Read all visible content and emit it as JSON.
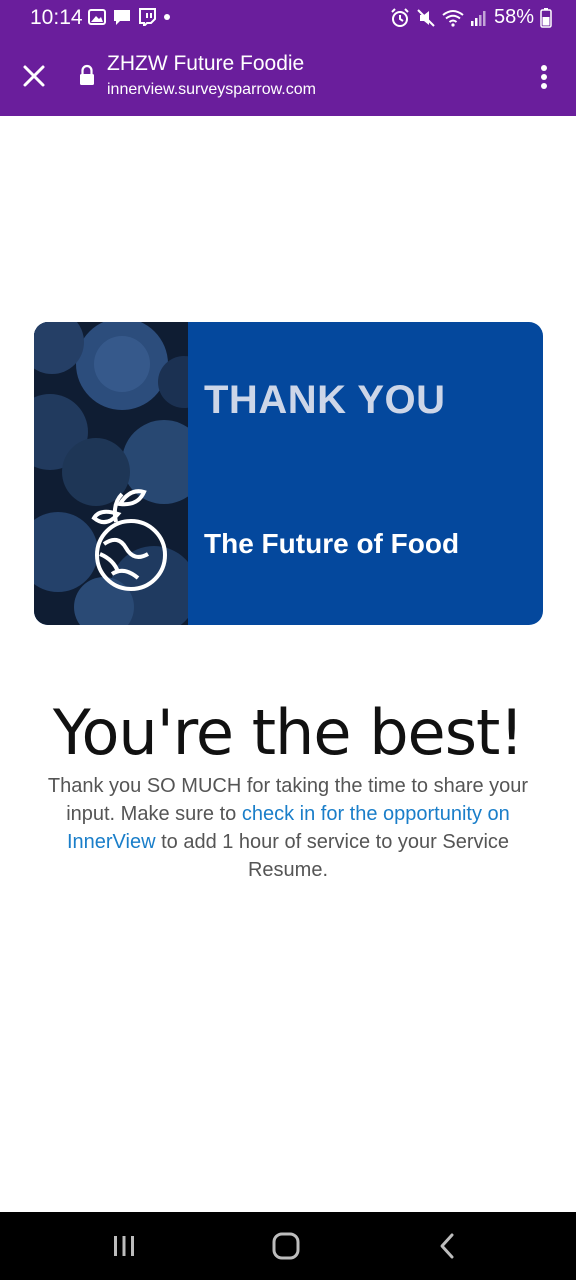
{
  "status_bar": {
    "time": "10:14",
    "battery": "58%",
    "icons": [
      "gallery-icon",
      "chat-icon",
      "twitch-icon",
      "dot-icon",
      "alarm-icon",
      "mute-icon",
      "wifi-icon",
      "signal-icon",
      "battery-icon"
    ]
  },
  "browser": {
    "title": "ZHZW Future Foodie",
    "url": "innerview.surveysparrow.com",
    "theme_color": "#6a1e9c"
  },
  "banner": {
    "heading": "THANK YOU",
    "subheading": "The Future of Food",
    "background_color": "#04489d"
  },
  "content": {
    "headline": "You're the best!",
    "message_before": "Thank you SO MUCH for taking the time to share your input. Make sure to ",
    "link_text": "check in for the opportunity on InnerView",
    "message_after": " to add 1 hour of service to your Service Resume.",
    "link_color": "#1a7ec9"
  },
  "nav": {
    "icons": [
      "recent-apps-icon",
      "home-icon",
      "back-icon"
    ]
  }
}
